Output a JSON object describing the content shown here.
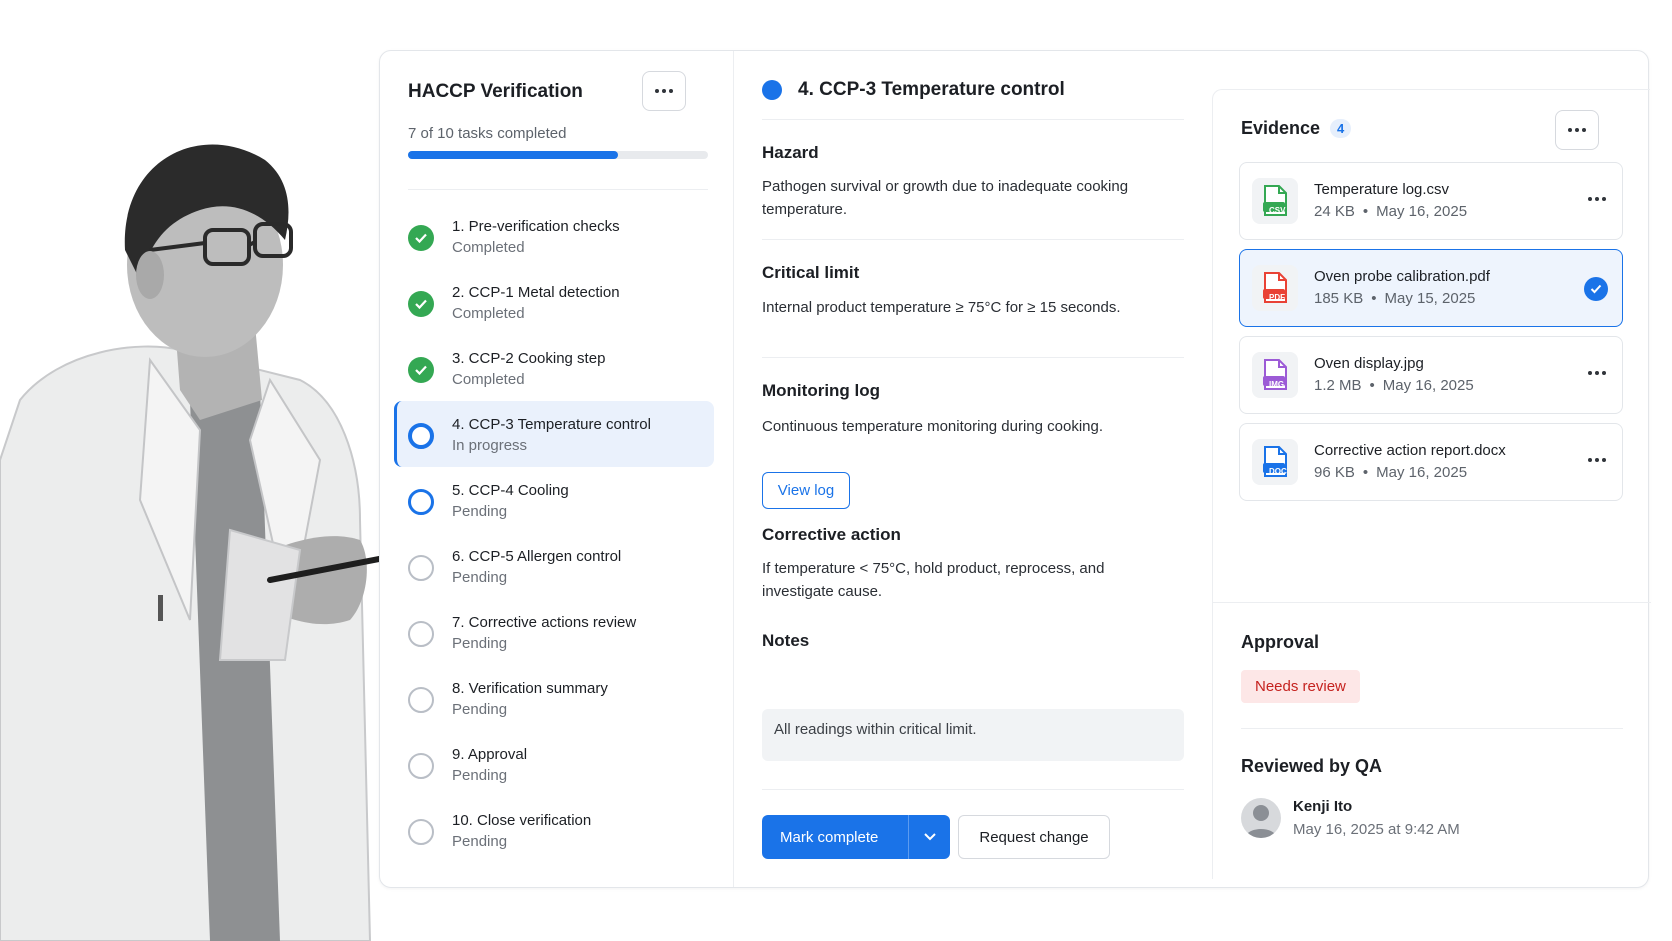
{
  "left_panel": {
    "title": "HACCP Verification",
    "subtitle": "7 of 10 tasks completed",
    "progress_fraction": 0.7,
    "tasks": [
      {
        "name": "1. Pre-verification checks",
        "state": "Completed",
        "status": "done"
      },
      {
        "name": "2. CCP-1 Metal detection",
        "state": "Completed",
        "status": "done"
      },
      {
        "name": "3. CCP-2 Cooking step",
        "state": "Completed",
        "status": "done"
      },
      {
        "name": "4. CCP-3 Temperature control",
        "state": "In progress",
        "status": "active"
      },
      {
        "name": "5. CCP-4 Cooling",
        "state": "Pending",
        "status": "pending"
      },
      {
        "name": "6. CCP-5 Allergen control",
        "state": "Pending",
        "status": "pending"
      },
      {
        "name": "7. Corrective actions review",
        "state": "Pending",
        "status": "pending"
      },
      {
        "name": "8. Verification summary",
        "state": "Pending",
        "status": "pending"
      },
      {
        "name": "9. Approval",
        "state": "Pending",
        "status": "pending"
      },
      {
        "name": "10. Close verification",
        "state": "Pending",
        "status": "pending"
      }
    ]
  },
  "detail": {
    "title": "4. CCP-3 Temperature control",
    "hazard_title": "Hazard",
    "hazard_text": "Pathogen survival or growth due to inadequate cooking temperature.",
    "limit_title": "Critical limit",
    "limit_text": "Internal product temperature ≥ 75°C for ≥ 15 seconds.",
    "monitoring_title": "Monitoring log",
    "monitoring_text": "Continuous temperature monitoring during cooking.",
    "view_log_label": "View log",
    "corrective_title": "Corrective action",
    "corrective_text": "If temperature < 75°C, hold product, reprocess, and investigate cause.",
    "notes_title": "Notes",
    "notes_text": "All readings within critical limit.",
    "mark_complete_label": "Mark complete",
    "request_change_label": "Request change"
  },
  "evidence": {
    "title": "Evidence",
    "count": "4",
    "files": [
      {
        "name": "Temperature log.csv",
        "size": "24 KB",
        "date": "May 16, 2025",
        "type_label": "CSV",
        "color": "#34a853",
        "selected": false
      },
      {
        "name": "Oven probe calibration.pdf",
        "size": "185 KB",
        "date": "May 15, 2025",
        "type_label": "PDF",
        "color": "#e94235",
        "selected": true
      },
      {
        "name": "Oven display.jpg",
        "size": "1.2 MB",
        "date": "May 16, 2025",
        "type_label": "IMG",
        "color": "#9c5bd6",
        "selected": false
      },
      {
        "name": "Corrective action report.docx",
        "size": "96 KB",
        "date": "May 16, 2025",
        "type_label": "DOC",
        "color": "#1a73e8",
        "selected": false
      }
    ]
  },
  "approval": {
    "title": "Approval",
    "badge": "Needs review",
    "reviewed_title": "Reviewed by QA",
    "reviewer_name": "Kenji Ito",
    "reviewed_at": "May 16, 2025 at 9:42 AM"
  },
  "colors": {
    "accent": "#1a73e8",
    "success": "#34a853",
    "danger": "#c5221f",
    "danger_bg": "#fde7e7"
  }
}
